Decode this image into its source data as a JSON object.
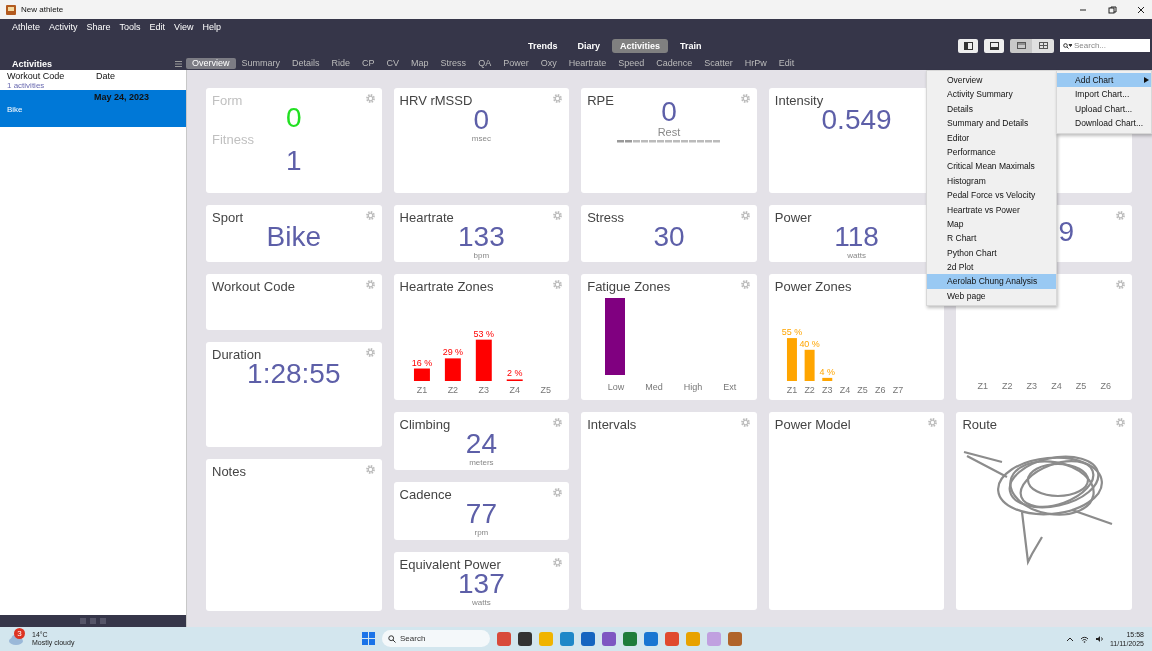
{
  "window": {
    "title": "New athlete"
  },
  "menu_bar": [
    "Athlete",
    "Activity",
    "Share",
    "Tools",
    "Edit",
    "View",
    "Help"
  ],
  "views": [
    {
      "label": "Trends",
      "selected": false
    },
    {
      "label": "Diary",
      "selected": false
    },
    {
      "label": "Activities",
      "selected": true
    },
    {
      "label": "Train",
      "selected": false
    }
  ],
  "view_modes": [
    {
      "kind": "tabs",
      "selected": true
    },
    {
      "kind": "tiles",
      "selected": false
    }
  ],
  "search": {
    "placeholder": "Search..."
  },
  "sidebar": {
    "title": "Activities",
    "columns": [
      "Workout Code",
      "Date"
    ],
    "group": "1 activities",
    "rows": [
      {
        "date": "May 24, 2023",
        "workout": "Bike",
        "selected": true
      }
    ]
  },
  "tabs": [
    {
      "label": "Overview",
      "selected": true
    },
    {
      "label": "Summary",
      "selected": false
    },
    {
      "label": "Details",
      "selected": false
    },
    {
      "label": "Ride",
      "selected": false
    },
    {
      "label": "CP",
      "selected": false
    },
    {
      "label": "CV",
      "selected": false
    },
    {
      "label": "Map",
      "selected": false
    },
    {
      "label": "Stress",
      "selected": false
    },
    {
      "label": "QA",
      "selected": false
    },
    {
      "label": "Power",
      "selected": false
    },
    {
      "label": "Oxy",
      "selected": false
    },
    {
      "label": "Heartrate",
      "selected": false
    },
    {
      "label": "Speed",
      "selected": false
    },
    {
      "label": "Cadence",
      "selected": false
    },
    {
      "label": "Scatter",
      "selected": false
    },
    {
      "label": "HrPw",
      "selected": false
    },
    {
      "label": "Edit",
      "selected": false
    }
  ],
  "dashboard": {
    "columns": [
      [
        {
          "kind": "dual",
          "title": "Form",
          "value": "0",
          "title_2": "Fitness",
          "value_2": "1",
          "settings": true
        },
        {
          "kind": "metric",
          "title": "Sport",
          "value": "Bike",
          "settings": true
        },
        {
          "kind": "empty",
          "title": "Workout Code",
          "settings": true
        },
        {
          "kind": "metric",
          "title": "Duration",
          "value": "1:28:55",
          "settings": true
        },
        {
          "kind": "empty",
          "title": "Notes",
          "settings": true
        }
      ],
      [
        {
          "kind": "metric",
          "title": "HRV rMSSD",
          "value": "0",
          "unit": "msec",
          "settings": true
        },
        {
          "kind": "metric",
          "title": "Heartrate",
          "value": "133",
          "unit": "bpm",
          "settings": true
        },
        {
          "kind": "zones",
          "title": "Heartrate Zones",
          "settings": true,
          "chart_data": {
            "type": "bar",
            "categories": [
              "Z1",
              "Z2",
              "Z3",
              "Z4",
              "Z5"
            ],
            "series": [
              {
                "color": "#ff0000",
                "values": [
                  16,
                  29,
                  53,
                  2,
                  null
                ],
                "value_labels": [
                  "16 %",
                  "29 %",
                  "53 %",
                  "2 %",
                  null
                ]
              }
            ]
          }
        },
        {
          "kind": "metric",
          "title": "Climbing",
          "value": "24",
          "unit": "meters",
          "settings": true
        },
        {
          "kind": "metric",
          "title": "Cadence",
          "value": "77",
          "unit": "rpm",
          "settings": true
        },
        {
          "kind": "metric",
          "title": "Equivalent Power",
          "value": "137",
          "unit": "watts",
          "settings": true
        }
      ],
      [
        {
          "kind": "rpe",
          "title": "RPE",
          "value": "0",
          "unit": "Rest",
          "settings": true
        },
        {
          "kind": "metric",
          "title": "Stress",
          "value": "30",
          "settings": true
        },
        {
          "kind": "fatigue",
          "title": "Fatigue Zones",
          "labels": [
            "Low",
            "Med",
            "High",
            "Ext"
          ],
          "settings": true
        },
        {
          "kind": "empty",
          "title": "Intervals",
          "settings": true
        }
      ],
      [
        {
          "kind": "metric",
          "title": "Intensity",
          "value": "0.549",
          "settings": false
        },
        {
          "kind": "metric",
          "title": "Power",
          "value": "118",
          "unit": "watts",
          "settings": false
        },
        {
          "kind": "zones",
          "title": "Power Zones",
          "settings": false,
          "chart_data": {
            "type": "bar",
            "categories": [
              "Z1",
              "Z2",
              "Z3",
              "Z4",
              "Z5",
              "Z6",
              "Z7"
            ],
            "series": [
              {
                "color": "#ffa500",
                "values": [
                  55,
                  40,
                  4,
                  null,
                  null,
                  null,
                  null
                ],
                "value_labels": [
                  "55 %",
                  "40 %",
                  "4 %",
                  null,
                  null,
                  null,
                  null
                ]
              }
            ]
          }
        },
        {
          "kind": "empty",
          "title": "Power Model",
          "settings": true
        }
      ],
      [
        {
          "kind": "empty",
          "settings": false
        },
        {
          "kind": "partial",
          "value": "9",
          "settings": true
        },
        {
          "kind": "axis",
          "labels": [
            "Z1",
            "Z2",
            "Z3",
            "Z4",
            "Z5",
            "Z6"
          ],
          "settings": true
        },
        {
          "kind": "route",
          "title": "Route",
          "settings": true
        }
      ]
    ]
  },
  "chart_menu": {
    "items": [
      {
        "label": "Add Chart",
        "kind": "submenu",
        "selected": true
      },
      {
        "label": "Import Chart...",
        "kind": "action",
        "selected": false
      },
      {
        "label": "Upload Chart...",
        "kind": "action",
        "selected": false
      },
      {
        "label": "Download Chart...",
        "kind": "action",
        "selected": false
      }
    ],
    "submenu": [
      {
        "label": "Overview",
        "selected": false
      },
      {
        "label": "Activity Summary",
        "selected": false
      },
      {
        "label": "Details",
        "selected": false
      },
      {
        "label": "Summary and Details",
        "selected": false
      },
      {
        "label": "Editor",
        "selected": false
      },
      {
        "label": "Performance",
        "selected": false
      },
      {
        "label": "Critical Mean Maximals",
        "selected": false
      },
      {
        "label": "Histogram",
        "selected": false
      },
      {
        "label": "Pedal Force vs Velocity",
        "selected": false
      },
      {
        "label": "Heartrate vs Power",
        "selected": false
      },
      {
        "label": "Map",
        "selected": false
      },
      {
        "label": "R Chart",
        "selected": false
      },
      {
        "label": "Python Chart",
        "selected": false
      },
      {
        "label": "2d Plot",
        "selected": false
      },
      {
        "label": "Aerolab Chung Analysis",
        "selected": true
      },
      {
        "label": "Web page",
        "selected": false
      }
    ]
  },
  "taskbar": {
    "weather": {
      "badge": "3",
      "temperature": "14°C",
      "condition": "Mostly cloudy"
    },
    "search": {
      "placeholder": "Search"
    },
    "time": "15:58",
    "date": "11/11/2025"
  }
}
